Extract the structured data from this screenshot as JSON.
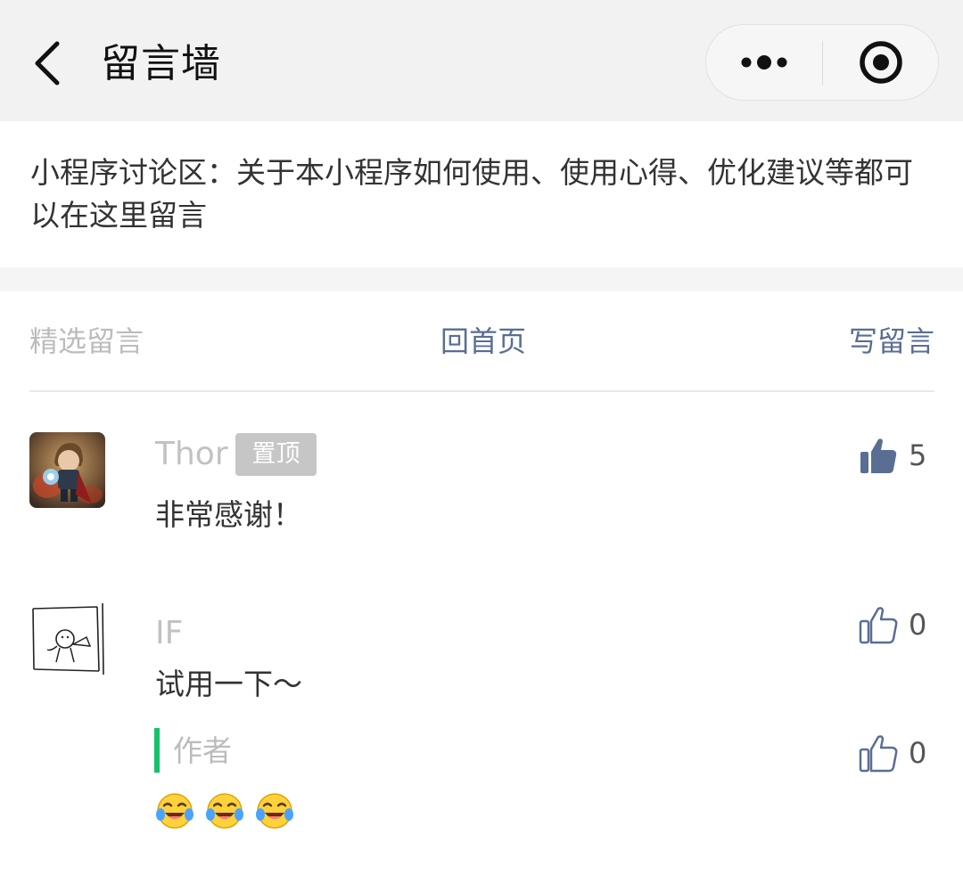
{
  "nav": {
    "title": "留言墙",
    "back_icon": "chevron-left-icon",
    "more_icon": "more-dots-icon",
    "close_icon": "target-circle-icon"
  },
  "intro": {
    "text": "小程序讨论区：关于本小程序如何使用、使用心得、优化建议等都可以在这里留言"
  },
  "tabs": {
    "featured": "精选留言",
    "home": "回首页",
    "write": "写留言"
  },
  "comments": [
    {
      "name": "Thor",
      "badge": "置顶",
      "content": "非常感谢！",
      "likes": "5",
      "liked": true
    },
    {
      "name": "IF",
      "content": "试用一下～",
      "likes": "0",
      "liked": false,
      "reply": {
        "author": "作者",
        "content": "😂😂😂",
        "likes": "0"
      }
    }
  ],
  "colors": {
    "accent": "#5a6e93",
    "reply_bar": "#15c26a",
    "nav_bg": "#f2f2f2"
  }
}
